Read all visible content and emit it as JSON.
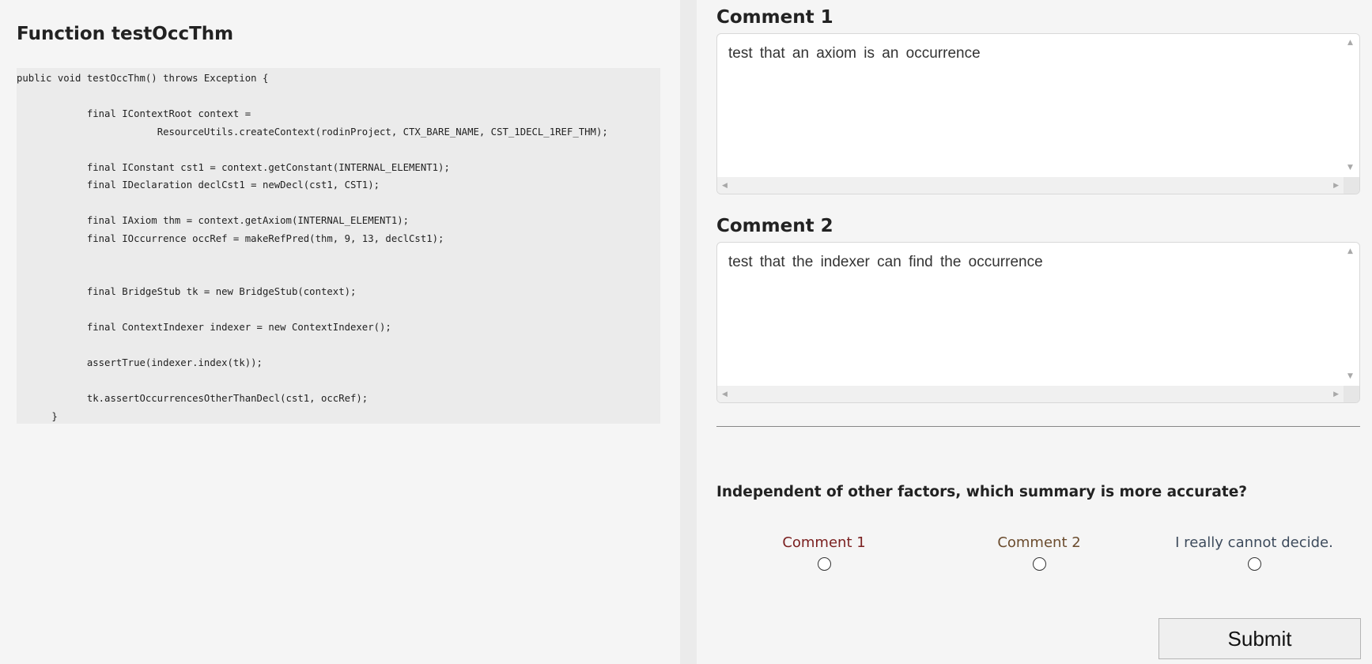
{
  "function": {
    "title": "Function testOccThm",
    "code": "public void testOccThm() throws Exception {\n\n\t\tfinal IContextRoot context =\n\t\t\t\tResourceUtils.createContext(rodinProject, CTX_BARE_NAME, CST_1DECL_1REF_THM);\n\n\t\tfinal IConstant cst1 = context.getConstant(INTERNAL_ELEMENT1);\n\t\tfinal IDeclaration declCst1 = newDecl(cst1, CST1);\n\n\t\tfinal IAxiom thm = context.getAxiom(INTERNAL_ELEMENT1);\n\t\tfinal IOccurrence occRef = makeRefPred(thm, 9, 13, declCst1);\n\n\n\t\tfinal BridgeStub tk = new BridgeStub(context);\n\n\t\tfinal ContextIndexer indexer = new ContextIndexer();\n\n\t\tassertTrue(indexer.index(tk));\n\n\t\ttk.assertOccurrencesOtherThanDecl(cst1, occRef);\n\t}"
  },
  "comment1": {
    "heading": "Comment 1",
    "text": "test that an axiom is an occurrence"
  },
  "comment2": {
    "heading": "Comment 2",
    "text": "test that the indexer can find the occurrence"
  },
  "question": {
    "text": "Independent of other factors, which summary is more accurate?",
    "options": [
      {
        "label": "Comment 1",
        "color": "#7a1f1f",
        "selected": false
      },
      {
        "label": "Comment 2",
        "color": "#6b4c2e",
        "selected": false
      },
      {
        "label": "I really cannot decide.",
        "color": "#3d4b5c",
        "selected": false
      }
    ]
  },
  "submit": {
    "label": "Submit"
  },
  "icons": {
    "scroll_up": "▲",
    "scroll_down": "▼",
    "scroll_left": "◀",
    "scroll_right": "▶"
  }
}
